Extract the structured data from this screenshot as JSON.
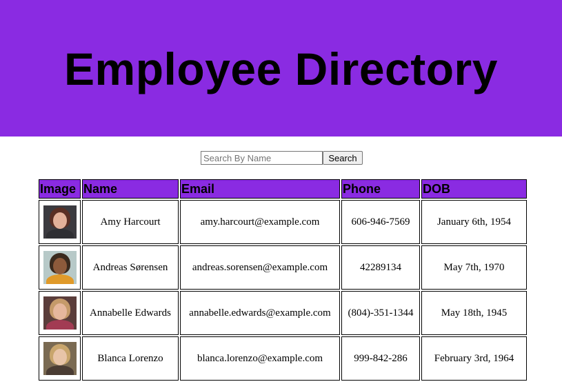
{
  "header": {
    "title": "Employee Directory",
    "bg_color": "#8a2be2"
  },
  "search": {
    "placeholder": "Search By Name",
    "value": "",
    "button_label": "Search"
  },
  "table": {
    "columns": [
      "Image",
      "Name",
      "Email",
      "Phone",
      "DOB"
    ],
    "rows": [
      {
        "name": "Amy Harcourt",
        "email": "amy.harcourt@example.com",
        "phone": "606-946-7569",
        "dob": "January 6th, 1954",
        "avatar": {
          "bg": "#3b3a3f",
          "hair": "#5a2f24",
          "face": "#e3b19a",
          "body": "#2f2f33"
        }
      },
      {
        "name": "Andreas Sørensen",
        "email": "andreas.sorensen@example.com",
        "phone": "42289134",
        "dob": "May 7th, 1970",
        "avatar": {
          "bg": "#b7c9c8",
          "hair": "#3a2a1e",
          "face": "#8d5a3b",
          "body": "#e09a2a"
        }
      },
      {
        "name": "Annabelle Edwards",
        "email": "annabelle.edwards@example.com",
        "phone": "(804)-351-1344",
        "dob": "May 18th, 1945",
        "avatar": {
          "bg": "#5a3d3b",
          "hair": "#c59a6a",
          "face": "#e6b79d",
          "body": "#a23b53"
        }
      },
      {
        "name": "Blanca Lorenzo",
        "email": "blanca.lorenzo@example.com",
        "phone": "999-842-286",
        "dob": "February 3rd, 1964",
        "avatar": {
          "bg": "#7a6a52",
          "hair": "#c8a56c",
          "face": "#e8c4a8",
          "body": "#4a3c33"
        }
      }
    ]
  }
}
